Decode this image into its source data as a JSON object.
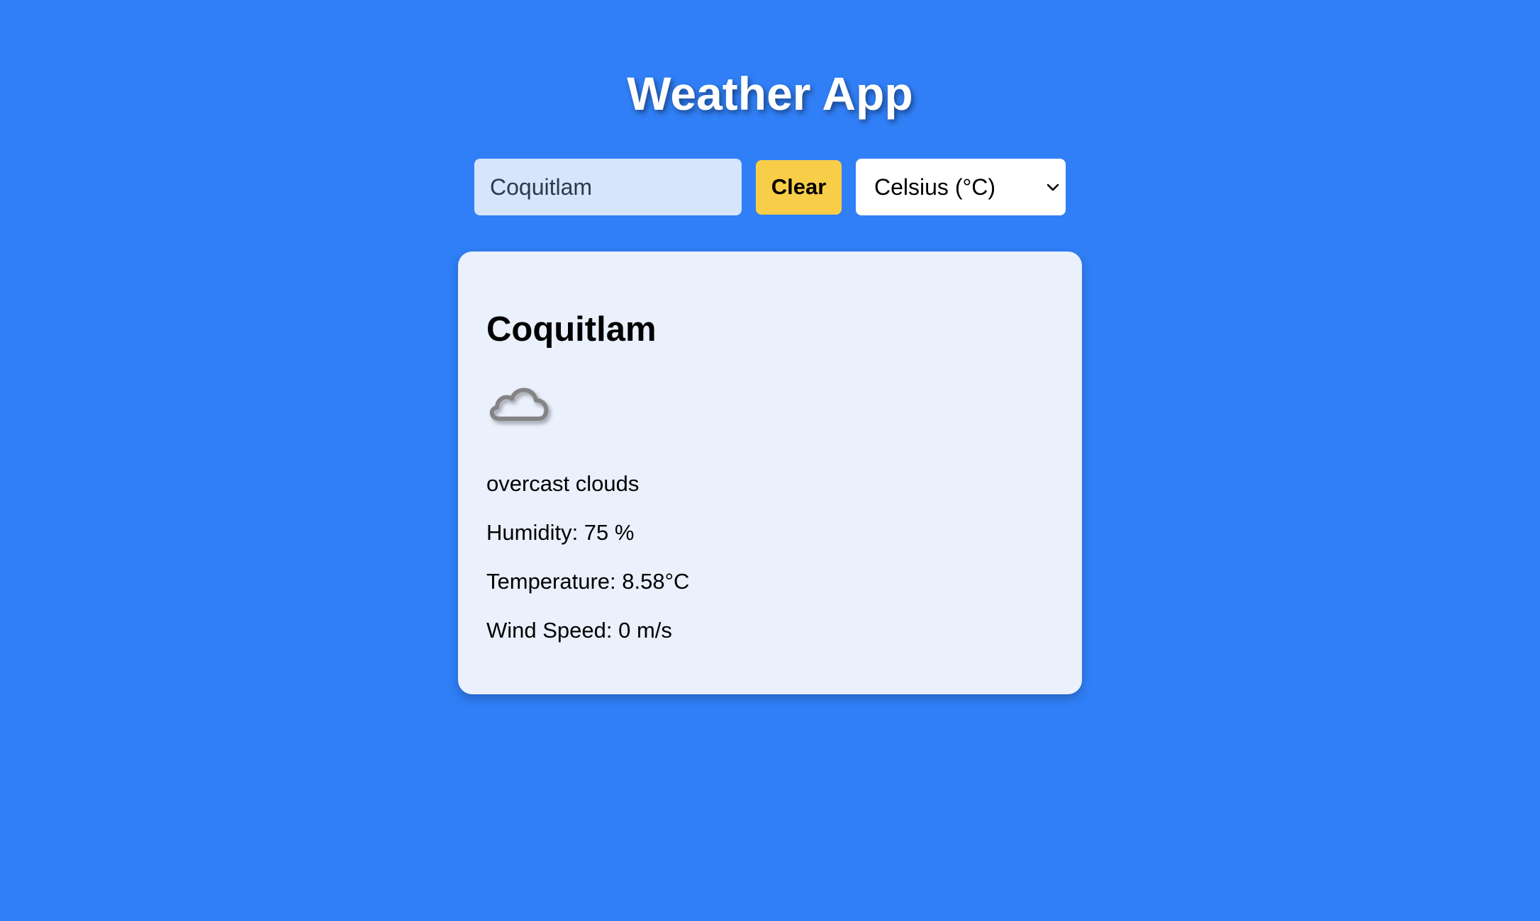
{
  "app": {
    "title": "Weather App"
  },
  "search": {
    "value": "Coquitlam"
  },
  "controls": {
    "clear_label": "Clear",
    "unit_selected": "Celsius (°C)"
  },
  "weather": {
    "city": "Coquitlam",
    "icon": "cloud-icon",
    "description": "overcast clouds",
    "humidity_text": "Humidity: 75 %",
    "temperature_text": "Temperature: 8.58°C",
    "wind_text": "Wind Speed: 0 m/s"
  },
  "colors": {
    "background": "#307ff7",
    "clear_button": "#f8cd48",
    "card": "#eaf0fc",
    "input": "#d6e5fc"
  }
}
